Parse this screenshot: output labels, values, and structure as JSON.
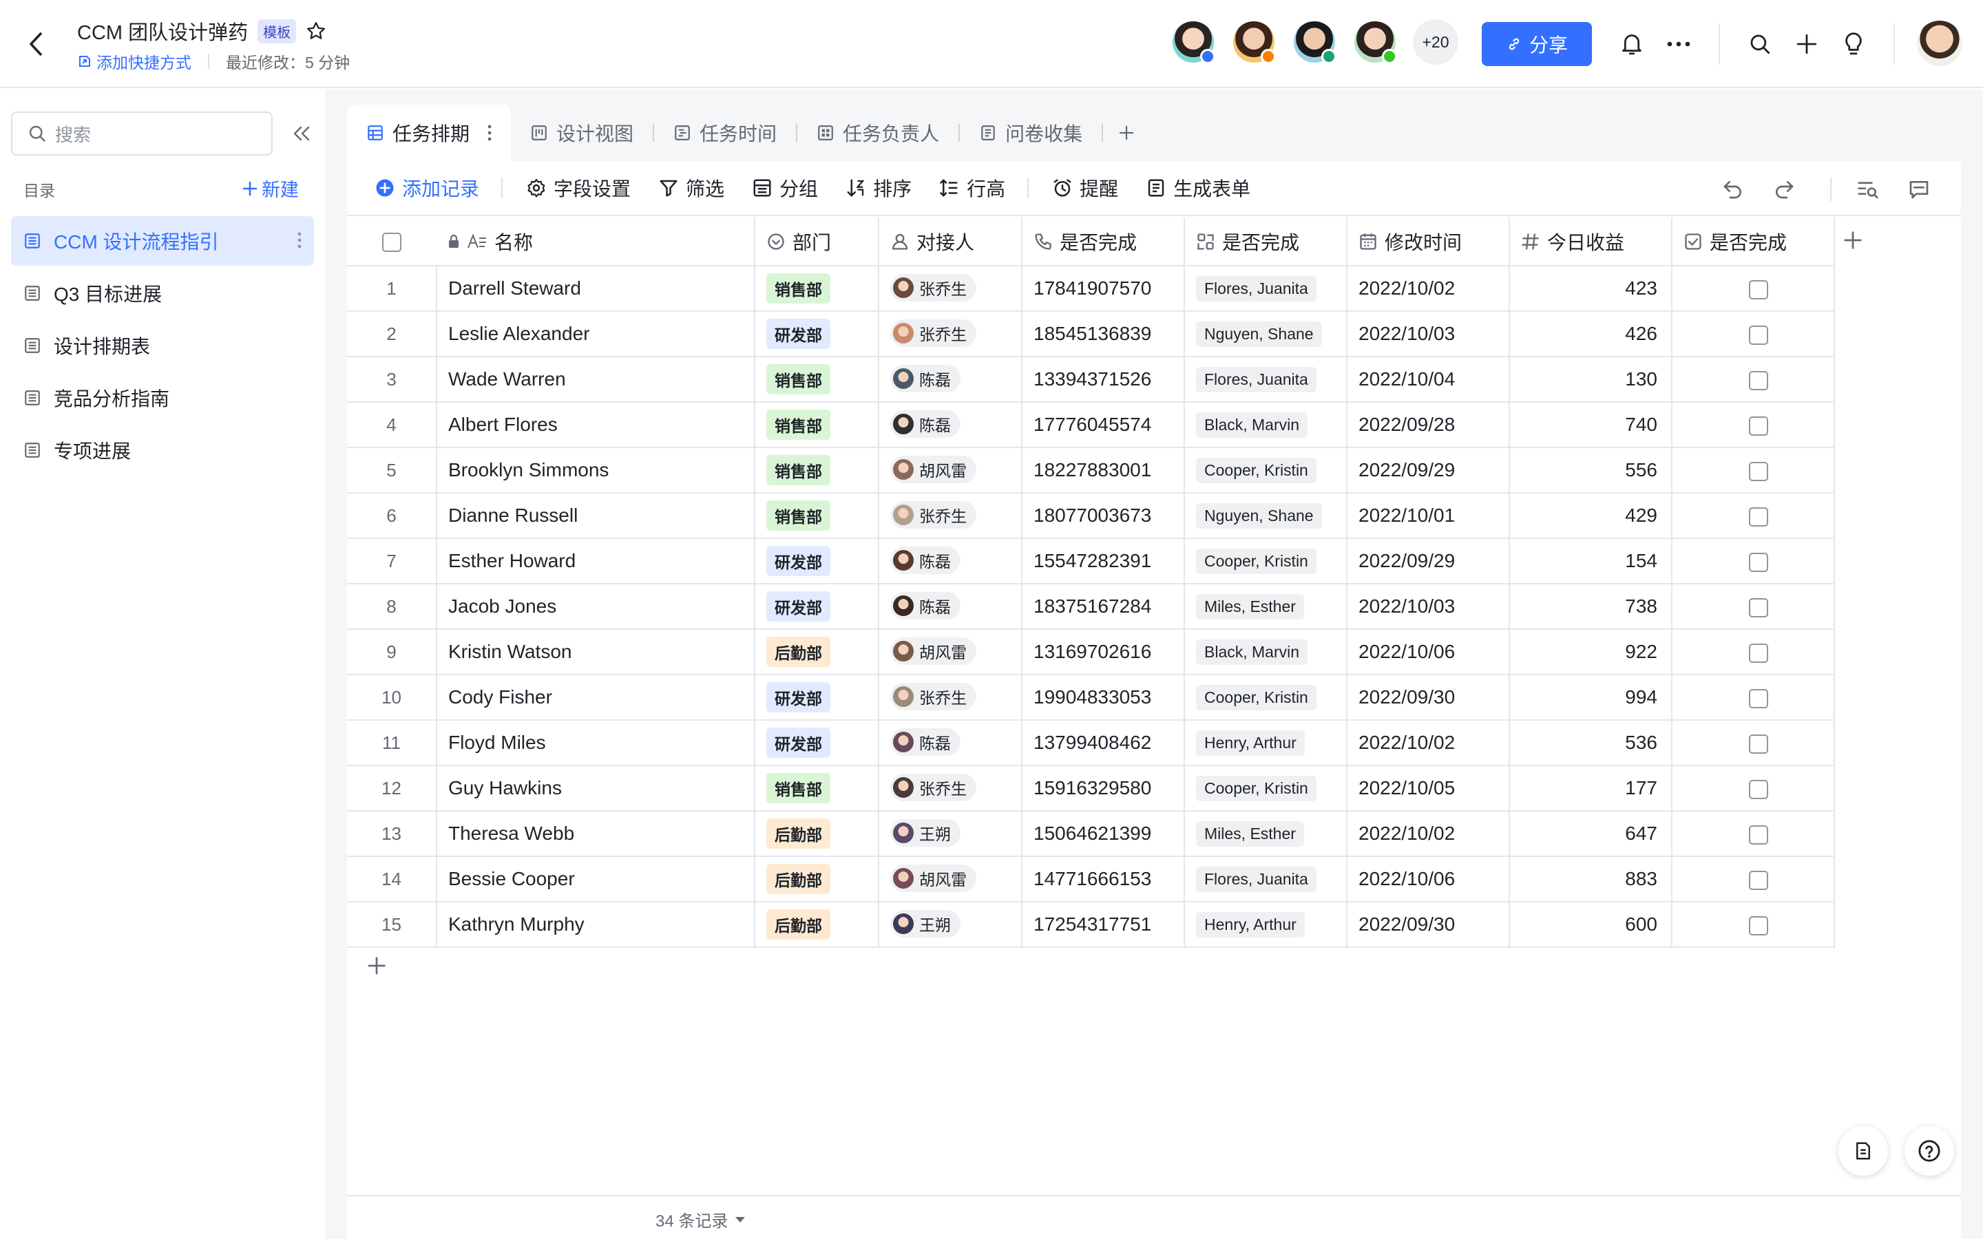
{
  "header": {
    "title": "CCM 团队设计弹药",
    "badge": "模板",
    "quick_link": "添加快捷方式",
    "last_modified": "最近修改：5 分钟",
    "more_count": "+20",
    "share_label": "分享"
  },
  "sidebar": {
    "search_placeholder": "搜索",
    "dir_label": "目录",
    "new_label": "新建",
    "items": [
      {
        "label": "CCM 设计流程指引"
      },
      {
        "label": "Q3 目标进展"
      },
      {
        "label": "设计排期表"
      },
      {
        "label": "竞品分析指南"
      },
      {
        "label": "专项进展"
      }
    ]
  },
  "tabs": [
    {
      "label": "任务排期"
    },
    {
      "label": "设计视图"
    },
    {
      "label": "任务时间"
    },
    {
      "label": "任务负责人"
    },
    {
      "label": "问卷收集"
    }
  ],
  "toolbar": {
    "add_record": "添加记录",
    "field_settings": "字段设置",
    "filter": "筛选",
    "group": "分组",
    "sort": "排序",
    "row_height": "行高",
    "reminder": "提醒",
    "form": "生成表单"
  },
  "columns": {
    "name": "名称",
    "dept": "部门",
    "contact": "对接人",
    "phone": "是否完成",
    "owner": "是否完成",
    "modified": "修改时间",
    "revenue": "今日收益",
    "done": "是否完成"
  },
  "rows": [
    {
      "idx": "1",
      "name": "Darrell Steward",
      "dept": "销售部",
      "person": "张乔生",
      "phone": "17841907570",
      "tag": "Flores, Juanita",
      "date": "2022/10/02",
      "rev": "423"
    },
    {
      "idx": "2",
      "name": "Leslie Alexander",
      "dept": "研发部",
      "person": "张乔生",
      "phone": "18545136839",
      "tag": "Nguyen, Shane",
      "date": "2022/10/03",
      "rev": "426"
    },
    {
      "idx": "3",
      "name": "Wade Warren",
      "dept": "销售部",
      "person": "陈磊",
      "phone": "13394371526",
      "tag": "Flores, Juanita",
      "date": "2022/10/04",
      "rev": "130"
    },
    {
      "idx": "4",
      "name": "Albert Flores",
      "dept": "销售部",
      "person": "陈磊",
      "phone": "17776045574",
      "tag": "Black, Marvin",
      "date": "2022/09/28",
      "rev": "740"
    },
    {
      "idx": "5",
      "name": "Brooklyn Simmons",
      "dept": "销售部",
      "person": "胡风雷",
      "phone": "18227883001",
      "tag": "Cooper, Kristin",
      "date": "2022/09/29",
      "rev": "556"
    },
    {
      "idx": "6",
      "name": "Dianne Russell",
      "dept": "销售部",
      "person": "张乔生",
      "phone": "18077003673",
      "tag": "Nguyen, Shane",
      "date": "2022/10/01",
      "rev": "429"
    },
    {
      "idx": "7",
      "name": "Esther Howard",
      "dept": "研发部",
      "person": "陈磊",
      "phone": "15547282391",
      "tag": "Cooper, Kristin",
      "date": "2022/09/29",
      "rev": "154"
    },
    {
      "idx": "8",
      "name": "Jacob Jones",
      "dept": "研发部",
      "person": "陈磊",
      "phone": "18375167284",
      "tag": "Miles, Esther",
      "date": "2022/10/03",
      "rev": "738"
    },
    {
      "idx": "9",
      "name": "Kristin Watson",
      "dept": "后勤部",
      "person": "胡风雷",
      "phone": "13169702616",
      "tag": "Black, Marvin",
      "date": "2022/10/06",
      "rev": "922"
    },
    {
      "idx": "10",
      "name": "Cody Fisher",
      "dept": "研发部",
      "person": "张乔生",
      "phone": "19904833053",
      "tag": "Cooper, Kristin",
      "date": "2022/09/30",
      "rev": "994"
    },
    {
      "idx": "11",
      "name": "Floyd Miles",
      "dept": "研发部",
      "person": "陈磊",
      "phone": "13799408462",
      "tag": "Henry, Arthur",
      "date": "2022/10/02",
      "rev": "536"
    },
    {
      "idx": "12",
      "name": "Guy Hawkins",
      "dept": "销售部",
      "person": "张乔生",
      "phone": "15916329580",
      "tag": "Cooper, Kristin",
      "date": "2022/10/05",
      "rev": "177"
    },
    {
      "idx": "13",
      "name": "Theresa Webb",
      "dept": "后勤部",
      "person": "王朔",
      "phone": "15064621399",
      "tag": "Miles, Esther",
      "date": "2022/10/02",
      "rev": "647"
    },
    {
      "idx": "14",
      "name": "Bessie Cooper",
      "dept": "后勤部",
      "person": "胡风雷",
      "phone": "14771666153",
      "tag": "Flores, Juanita",
      "date": "2022/10/06",
      "rev": "883"
    },
    {
      "idx": "15",
      "name": "Kathryn Murphy",
      "dept": "后勤部",
      "person": "王朔",
      "phone": "17254317751",
      "tag": "Henry, Arthur",
      "date": "2022/09/30",
      "rev": "600"
    }
  ],
  "footer": {
    "record_count": "34 条记录"
  },
  "colors": {
    "accent": "#3370ff",
    "sale": "#d9f5d6",
    "rd": "#e1eaff",
    "back": "#feead2"
  }
}
